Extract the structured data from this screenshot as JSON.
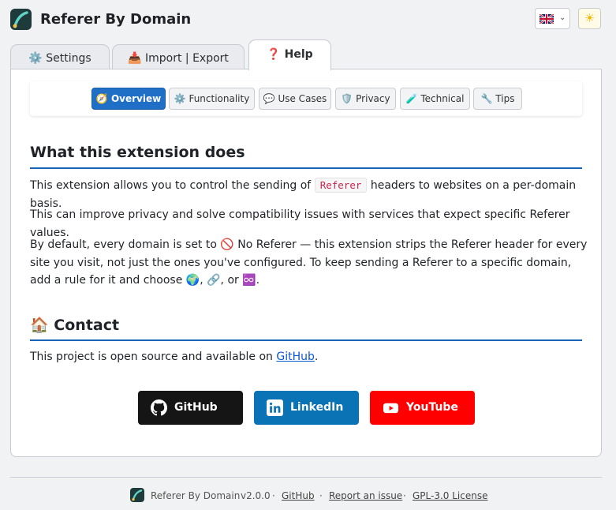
{
  "app": {
    "title": "Referer By Domain"
  },
  "header": {
    "language_flag": "uk-flag",
    "theme_icon": "sun-icon"
  },
  "tabs": [
    {
      "icon": "⚙️",
      "label": "Settings"
    },
    {
      "icon": "📥",
      "label": "Import | Export"
    },
    {
      "icon": "❓",
      "label": "Help",
      "active": true
    }
  ],
  "help_nav": [
    {
      "icon": "🧭",
      "label": "Overview",
      "active": true
    },
    {
      "icon": "⚙️",
      "label": "Functionality"
    },
    {
      "icon": "💬",
      "label": "Use Cases"
    },
    {
      "icon": "🛡️",
      "label": "Privacy"
    },
    {
      "icon": "🧪",
      "label": "Technical"
    },
    {
      "icon": "🔧",
      "label": "Tips"
    }
  ],
  "overview": {
    "heading": "What this extension does",
    "p1_before": "This extension allows you to control the sending of",
    "p1_code": "Referer",
    "p1_after": "headers to websites on a per-domain basis.",
    "p2": "This can improve privacy and solve compatibility issues with services that expect specific Referer values.",
    "p3_a": "By default, every domain is set to 🚫 No Referer — this extension strips the Referer header for every site you visit, not just the ones you've configured. To keep sending a Referer to a specific domain, add a rule for it and choose 🌍, 🔗, or ♾️."
  },
  "contact": {
    "icon": "🏠",
    "heading": "Contact",
    "text_before": "This project is open source and available on",
    "link": "GitHub",
    "text_after": "."
  },
  "social": [
    {
      "label": "GitHub",
      "icon": "github-icon",
      "color": "#151515"
    },
    {
      "label": "LinkedIn",
      "icon": "linkedin-icon",
      "color": "#0a73b5"
    },
    {
      "label": "YouTube",
      "icon": "youtube-icon",
      "color": "#ff0000"
    }
  ],
  "footer": {
    "name": "Referer By Domain",
    "version": "v2.0.0",
    "github": "GitHub",
    "issue": "Report an issue",
    "license": "GPL-3.0 License",
    "sep": "·"
  }
}
